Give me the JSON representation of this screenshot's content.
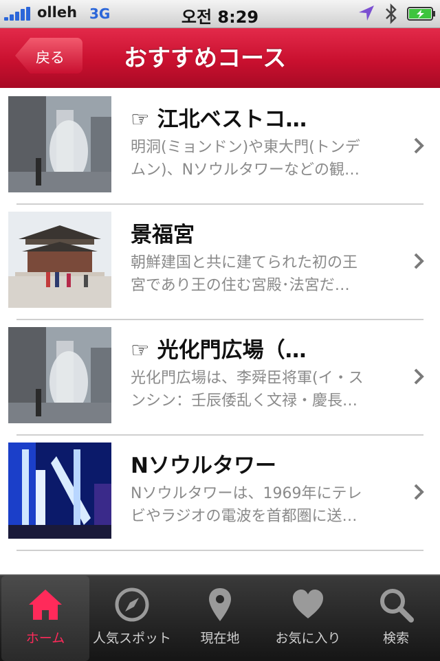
{
  "status_bar": {
    "carrier": "olleh",
    "network": "3G",
    "time": "오전 8:29"
  },
  "nav": {
    "back_label": "戻る",
    "title": "おすすめコース"
  },
  "items": [
    {
      "title": "☞ 江北ベストコ…",
      "desc_line1": "明洞(ミョンドン)や東大門(トンデ",
      "desc_line2": "ムン)、Nソウルタワーなどの観…",
      "thumb": "fountain-photo"
    },
    {
      "title": "景福宮",
      "desc_line1": "朝鮮建国と共に建てられた初の王",
      "desc_line2": "宮であり王の住む宮殿･法宮だ…",
      "thumb": "palace-photo"
    },
    {
      "title": "☞ 光化門広場（…",
      "desc_line1": "光化門広場は、李舜臣将軍(イ・ス",
      "desc_line2": "ンシン：壬辰倭乱く文禄・慶長…",
      "thumb": "fountain-photo"
    },
    {
      "title": "Nソウルタワー",
      "desc_line1": "Nソウルタワーは、1969年にテレ",
      "desc_line2": "ビやラジオの電波を首都圏に送…",
      "thumb": "tower-photo"
    }
  ],
  "tabs": [
    {
      "label": "ホーム",
      "icon": "home-icon",
      "active": true
    },
    {
      "label": "人気スポット",
      "icon": "compass-icon",
      "active": false
    },
    {
      "label": "現在地",
      "icon": "map-pin-icon",
      "active": false
    },
    {
      "label": "お気に入り",
      "icon": "heart-icon",
      "active": false
    },
    {
      "label": "検索",
      "icon": "search-icon",
      "active": false
    }
  ],
  "colors": {
    "nav_red": "#c9102f",
    "active_tab": "#ff2a5a",
    "description_gray": "#8a8a8a"
  }
}
